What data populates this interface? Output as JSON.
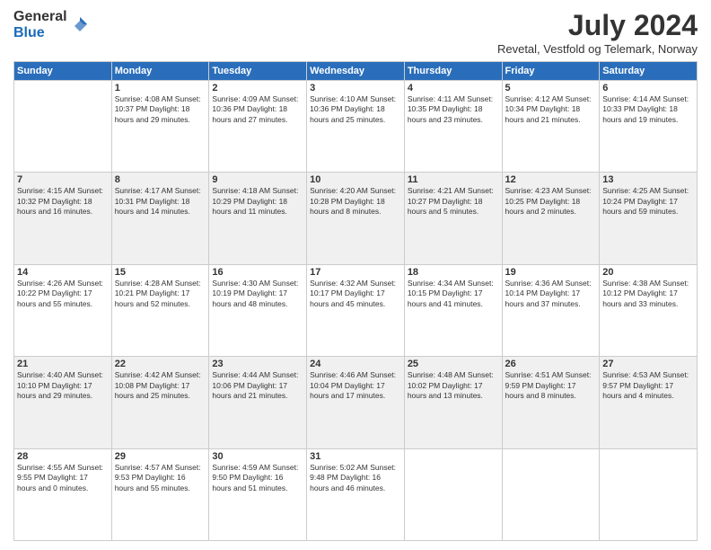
{
  "logo": {
    "general": "General",
    "blue": "Blue"
  },
  "header": {
    "title": "July 2024",
    "subtitle": "Revetal, Vestfold og Telemark, Norway"
  },
  "weekdays": [
    "Sunday",
    "Monday",
    "Tuesday",
    "Wednesday",
    "Thursday",
    "Friday",
    "Saturday"
  ],
  "weeks": [
    [
      {
        "day": "",
        "info": ""
      },
      {
        "day": "1",
        "info": "Sunrise: 4:08 AM\nSunset: 10:37 PM\nDaylight: 18 hours\nand 29 minutes."
      },
      {
        "day": "2",
        "info": "Sunrise: 4:09 AM\nSunset: 10:36 PM\nDaylight: 18 hours\nand 27 minutes."
      },
      {
        "day": "3",
        "info": "Sunrise: 4:10 AM\nSunset: 10:36 PM\nDaylight: 18 hours\nand 25 minutes."
      },
      {
        "day": "4",
        "info": "Sunrise: 4:11 AM\nSunset: 10:35 PM\nDaylight: 18 hours\nand 23 minutes."
      },
      {
        "day": "5",
        "info": "Sunrise: 4:12 AM\nSunset: 10:34 PM\nDaylight: 18 hours\nand 21 minutes."
      },
      {
        "day": "6",
        "info": "Sunrise: 4:14 AM\nSunset: 10:33 PM\nDaylight: 18 hours\nand 19 minutes."
      }
    ],
    [
      {
        "day": "7",
        "info": "Sunrise: 4:15 AM\nSunset: 10:32 PM\nDaylight: 18 hours\nand 16 minutes."
      },
      {
        "day": "8",
        "info": "Sunrise: 4:17 AM\nSunset: 10:31 PM\nDaylight: 18 hours\nand 14 minutes."
      },
      {
        "day": "9",
        "info": "Sunrise: 4:18 AM\nSunset: 10:29 PM\nDaylight: 18 hours\nand 11 minutes."
      },
      {
        "day": "10",
        "info": "Sunrise: 4:20 AM\nSunset: 10:28 PM\nDaylight: 18 hours\nand 8 minutes."
      },
      {
        "day": "11",
        "info": "Sunrise: 4:21 AM\nSunset: 10:27 PM\nDaylight: 18 hours\nand 5 minutes."
      },
      {
        "day": "12",
        "info": "Sunrise: 4:23 AM\nSunset: 10:25 PM\nDaylight: 18 hours\nand 2 minutes."
      },
      {
        "day": "13",
        "info": "Sunrise: 4:25 AM\nSunset: 10:24 PM\nDaylight: 17 hours\nand 59 minutes."
      }
    ],
    [
      {
        "day": "14",
        "info": "Sunrise: 4:26 AM\nSunset: 10:22 PM\nDaylight: 17 hours\nand 55 minutes."
      },
      {
        "day": "15",
        "info": "Sunrise: 4:28 AM\nSunset: 10:21 PM\nDaylight: 17 hours\nand 52 minutes."
      },
      {
        "day": "16",
        "info": "Sunrise: 4:30 AM\nSunset: 10:19 PM\nDaylight: 17 hours\nand 48 minutes."
      },
      {
        "day": "17",
        "info": "Sunrise: 4:32 AM\nSunset: 10:17 PM\nDaylight: 17 hours\nand 45 minutes."
      },
      {
        "day": "18",
        "info": "Sunrise: 4:34 AM\nSunset: 10:15 PM\nDaylight: 17 hours\nand 41 minutes."
      },
      {
        "day": "19",
        "info": "Sunrise: 4:36 AM\nSunset: 10:14 PM\nDaylight: 17 hours\nand 37 minutes."
      },
      {
        "day": "20",
        "info": "Sunrise: 4:38 AM\nSunset: 10:12 PM\nDaylight: 17 hours\nand 33 minutes."
      }
    ],
    [
      {
        "day": "21",
        "info": "Sunrise: 4:40 AM\nSunset: 10:10 PM\nDaylight: 17 hours\nand 29 minutes."
      },
      {
        "day": "22",
        "info": "Sunrise: 4:42 AM\nSunset: 10:08 PM\nDaylight: 17 hours\nand 25 minutes."
      },
      {
        "day": "23",
        "info": "Sunrise: 4:44 AM\nSunset: 10:06 PM\nDaylight: 17 hours\nand 21 minutes."
      },
      {
        "day": "24",
        "info": "Sunrise: 4:46 AM\nSunset: 10:04 PM\nDaylight: 17 hours\nand 17 minutes."
      },
      {
        "day": "25",
        "info": "Sunrise: 4:48 AM\nSunset: 10:02 PM\nDaylight: 17 hours\nand 13 minutes."
      },
      {
        "day": "26",
        "info": "Sunrise: 4:51 AM\nSunset: 9:59 PM\nDaylight: 17 hours\nand 8 minutes."
      },
      {
        "day": "27",
        "info": "Sunrise: 4:53 AM\nSunset: 9:57 PM\nDaylight: 17 hours\nand 4 minutes."
      }
    ],
    [
      {
        "day": "28",
        "info": "Sunrise: 4:55 AM\nSunset: 9:55 PM\nDaylight: 17 hours\nand 0 minutes."
      },
      {
        "day": "29",
        "info": "Sunrise: 4:57 AM\nSunset: 9:53 PM\nDaylight: 16 hours\nand 55 minutes."
      },
      {
        "day": "30",
        "info": "Sunrise: 4:59 AM\nSunset: 9:50 PM\nDaylight: 16 hours\nand 51 minutes."
      },
      {
        "day": "31",
        "info": "Sunrise: 5:02 AM\nSunset: 9:48 PM\nDaylight: 16 hours\nand 46 minutes."
      },
      {
        "day": "",
        "info": ""
      },
      {
        "day": "",
        "info": ""
      },
      {
        "day": "",
        "info": ""
      }
    ]
  ]
}
